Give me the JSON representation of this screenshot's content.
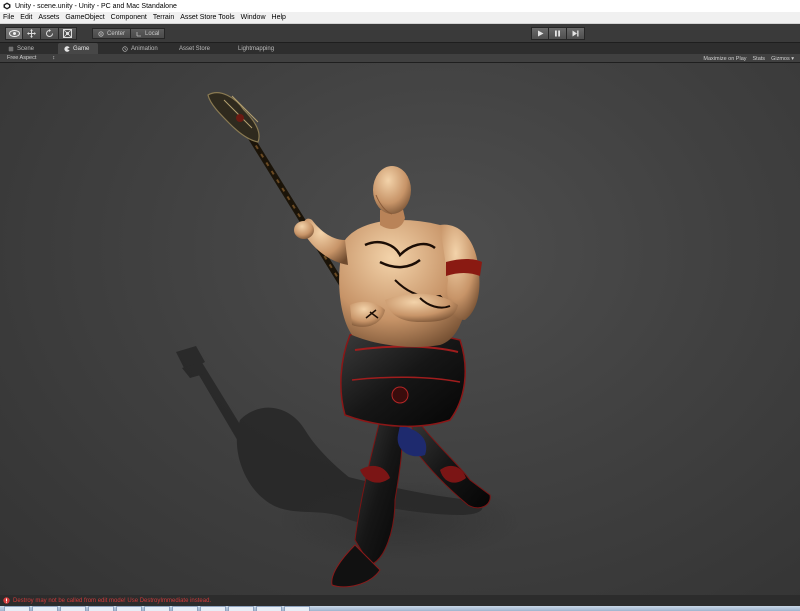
{
  "window": {
    "title": "Unity - scene.unity - Unity - PC and Mac Standalone"
  },
  "menu": [
    "File",
    "Edit",
    "Assets",
    "GameObject",
    "Component",
    "Terrain",
    "Asset Store Tools",
    "Window",
    "Help"
  ],
  "toolbar": {
    "pivot_label": "Center",
    "space_label": "Local"
  },
  "tabs": {
    "scene": "Scene",
    "game": "Game",
    "animation": "Animation",
    "asset_store": "Asset Store",
    "lightmapping": "Lightmapping"
  },
  "game_view": {
    "aspect": "Free Aspect",
    "aspect_arrow": "↕",
    "maximize": "Maximize on Play",
    "stats": "Stats",
    "gizmos": "Gizmos",
    "gizmos_arrow": "▾"
  },
  "console": {
    "message": "Destroy may not be called from edit mode! Use DestroyImmediate instead."
  },
  "colors": {
    "error": "#d13a3a",
    "toolbar": "#3a3a3a",
    "active_tab": "#474747"
  }
}
